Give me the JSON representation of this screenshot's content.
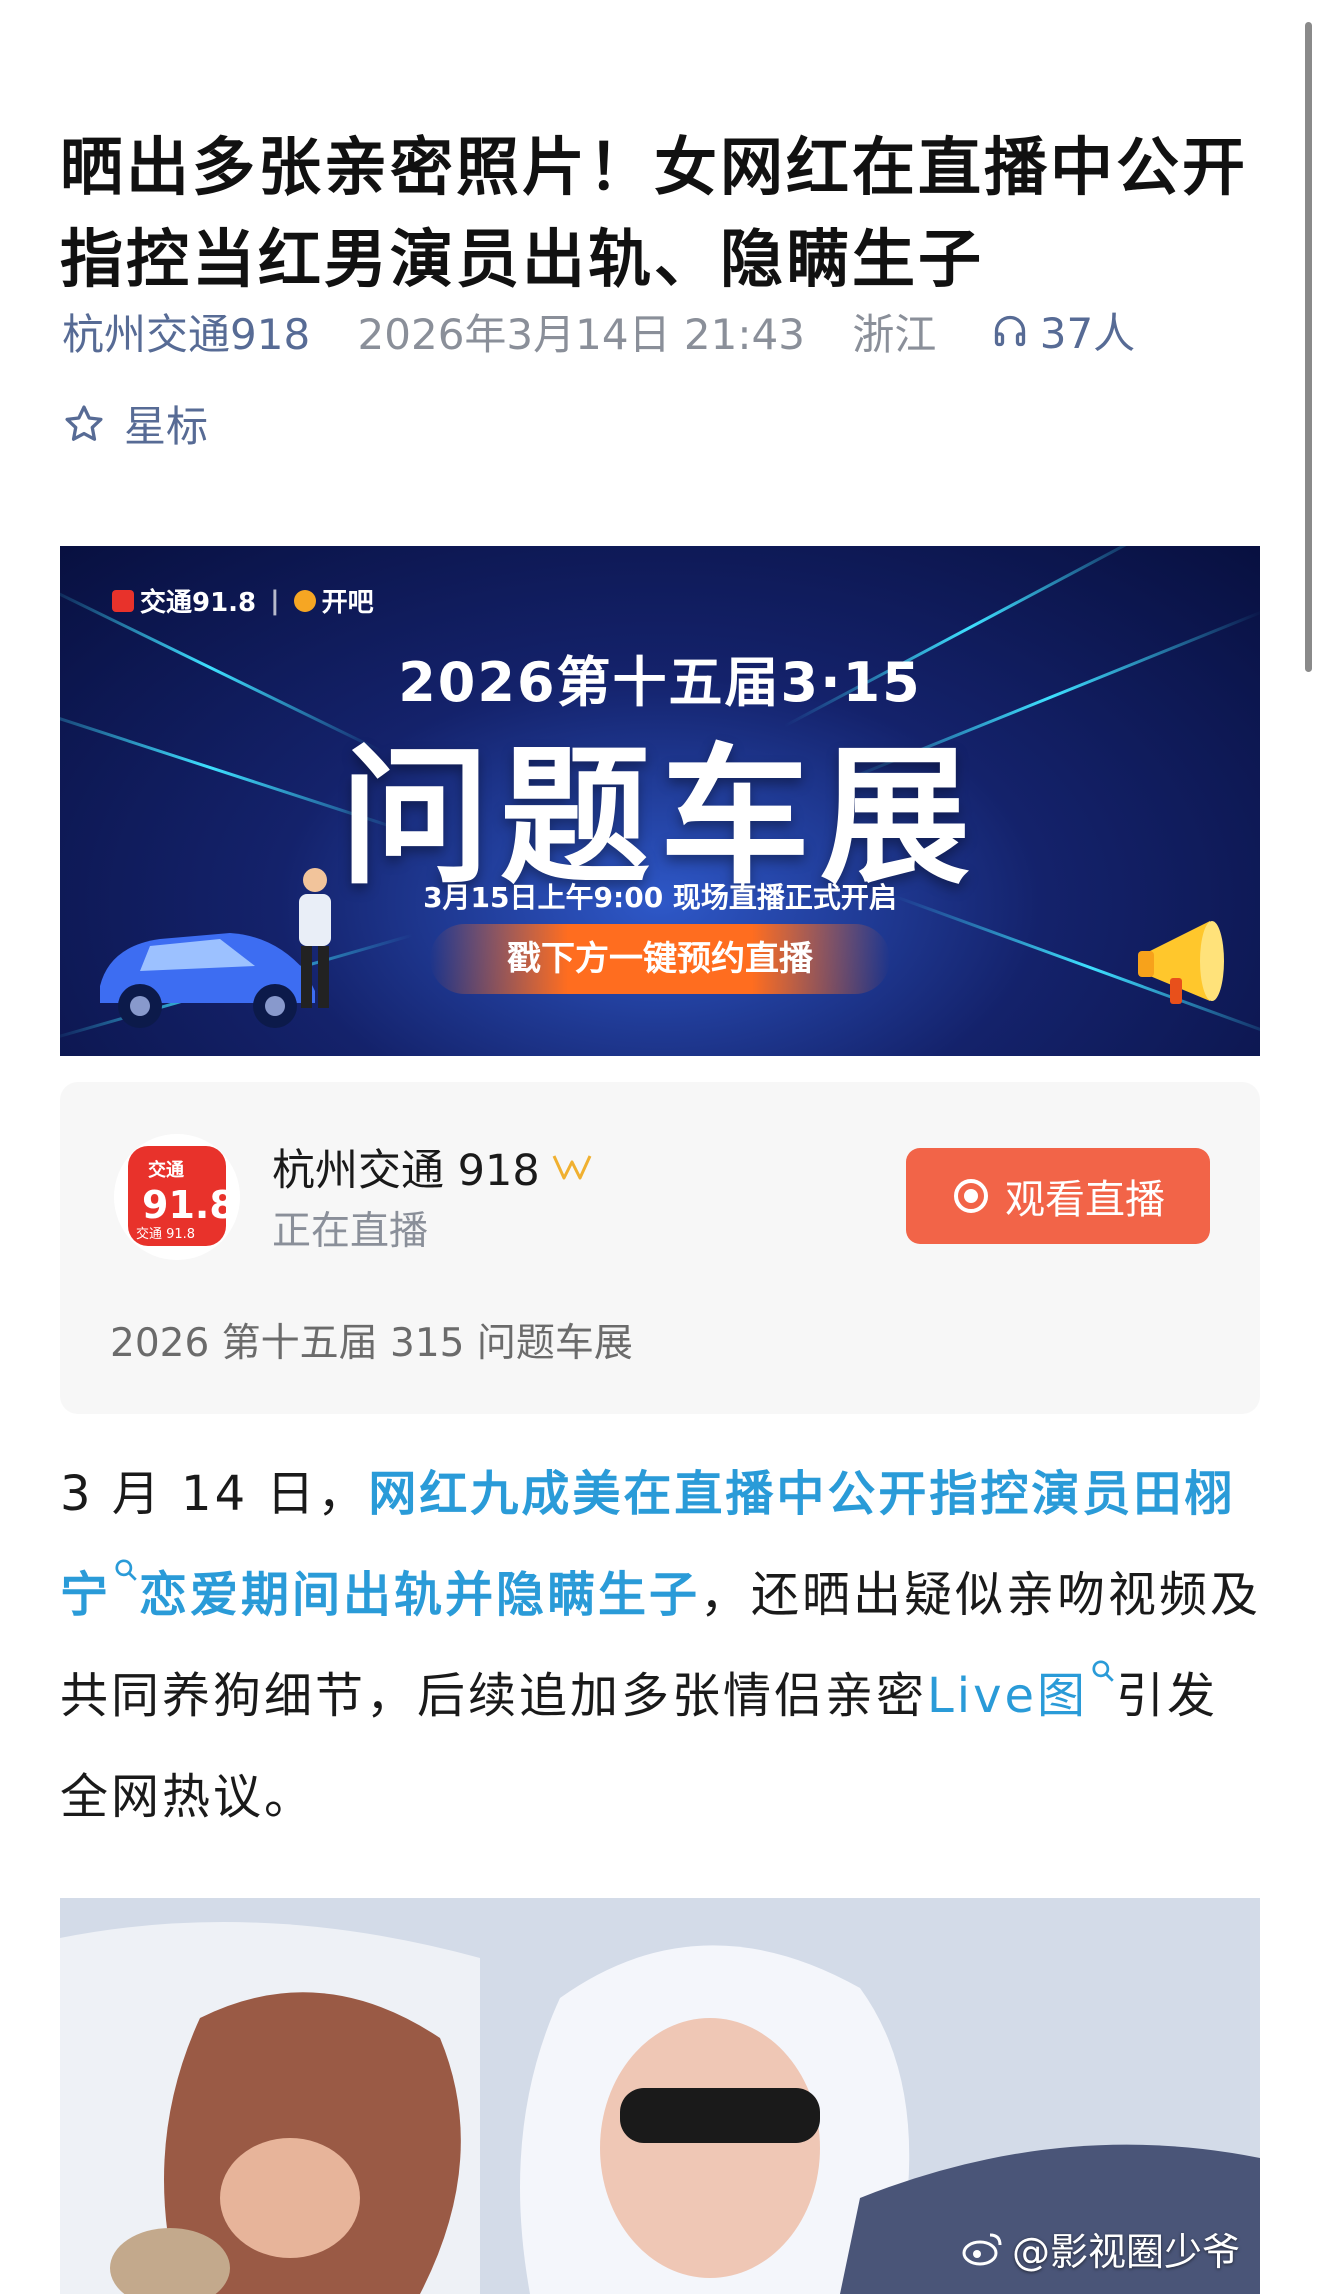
{
  "article": {
    "title": "晒出多张亲密照片！女网红在直播中公开指控当红男演员出轨、隐瞒生子",
    "source": "杭州交通918",
    "date": "2026年3月14日 21:43",
    "region": "浙江",
    "listeners": "37人",
    "star_label": "星标"
  },
  "banner": {
    "logo1": "交通91.8",
    "logo2": "开吧",
    "headline": "2026第十五届3·15",
    "big_title": "问题车展",
    "time_text": "3月15日上午9:00  现场直播正式开启",
    "cta": "戳下方一键预约直播"
  },
  "live_card": {
    "name": "杭州交通 918",
    "status": "正在直播",
    "button": "观看直播",
    "description": "2026 第十五届 315 问题车展",
    "avatar_text_top": "交通",
    "avatar_text_big": "91.8",
    "avatar_text_bottom": "交通 91.8"
  },
  "body": {
    "p1_plain_1": "3 月 14 日，",
    "p1_bold_link": "网红九成美在直播中公开指控演员田栩宁",
    "p1_bold_link_2": "恋爱期间出轨并隐瞒生子",
    "p1_plain_2": "，还晒出疑似亲吻视频及共同养狗细节，后续追加多张情侣亲密",
    "p1_link": "Live图",
    "p1_plain_3": "引发全网热议。"
  },
  "watermark": "@影视圈少爷",
  "colors": {
    "link": "#576b95",
    "highlight": "#2a9bd8",
    "watch_button": "#f26448",
    "meta_gray": "#8a8f99"
  }
}
